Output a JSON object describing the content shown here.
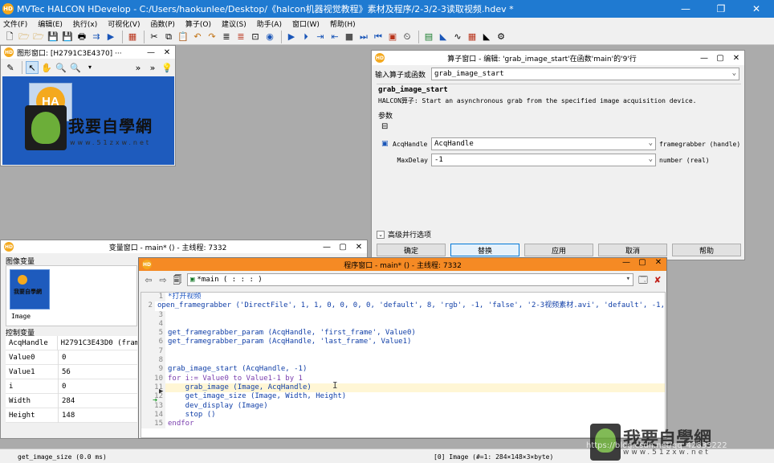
{
  "app": {
    "title": "MVTec HALCON HDevelop - C:/Users/haokunlee/Desktop/《halcon机器视觉教程》素材及程序/2-3/2-3读取视频.hdev *",
    "minimize": "—",
    "maximize": "❐",
    "close": "✕"
  },
  "menu": [
    "文件(F)",
    "编辑(E)",
    "执行(x)",
    "可视化(V)",
    "函数(P)",
    "算子(O)",
    "建议(S)",
    "助手(A)",
    "窗口(W)",
    "帮助(H)"
  ],
  "graphics_window": {
    "title": "图形窗口: [H2791C3E4370] ···",
    "overlay_text": "我要自學網",
    "overlay_sub": "www.51zxw.net"
  },
  "operator_window": {
    "title": "算子窗口 - 编辑: 'grab_image_start'在函数'main'的'9'行",
    "input_label": "输入算子或函数",
    "input_value": "grab_image_start",
    "op_name": "grab_image_start",
    "op_desc": "HALCON算子:  Start an asynchronous grab from the specified image acquisition device.",
    "params_label": "参数",
    "params": [
      {
        "name": "AcqHandle",
        "value": "AcqHandle",
        "type": "framegrabber (handle)"
      },
      {
        "name": "MaxDelay",
        "value": "-1",
        "type": "number (real)"
      }
    ],
    "advanced_label": "高级并行选项",
    "buttons": [
      "确定",
      "替换",
      "应用",
      "取消",
      "帮助"
    ]
  },
  "variable_window": {
    "title": "变量窗口 - main* () - 主线程: 7332",
    "image_section": "图像变量",
    "image_var_name": "Image",
    "control_section": "控制变量",
    "variables": [
      {
        "name": "AcqHandle",
        "value": "H2791C3E43D0 (fram"
      },
      {
        "name": "Value0",
        "value": "0"
      },
      {
        "name": "Value1",
        "value": "56"
      },
      {
        "name": "i",
        "value": "0"
      },
      {
        "name": "Width",
        "value": "284"
      },
      {
        "name": "Height",
        "value": "148"
      }
    ]
  },
  "program_window": {
    "title": "程序窗口 - main* () - 主线程: 7332",
    "procedure": "*main ( : : : )",
    "lines": [
      {
        "n": "1",
        "text": "*打开视频"
      },
      {
        "n": "2",
        "text": "open_framegrabber ('DirectFile', 1, 1, 0, 0, 0, 0, 'default', 8, 'rgb', -1, 'false', '2-3视频素材.avi', 'default', -1,"
      },
      {
        "n": "3",
        "text": ""
      },
      {
        "n": "4",
        "text": ""
      },
      {
        "n": "5",
        "text": "get_framegrabber_param (AcqHandle, 'first_frame', Value0)"
      },
      {
        "n": "6",
        "text": "get_framegrabber_param (AcqHandle, 'last_frame', Value1)"
      },
      {
        "n": "7",
        "text": ""
      },
      {
        "n": "8",
        "text": ""
      },
      {
        "n": "9",
        "text": "grab_image_start (AcqHandle, -1)"
      },
      {
        "n": "10",
        "text": "for i:= Value0 to Value1-1 by 1"
      },
      {
        "n": "11",
        "text": "    grab_image (Image, AcqHandle)"
      },
      {
        "n": "12",
        "text": "    get_image_size (Image, Width, Height)"
      },
      {
        "n": "13",
        "text": "    dev_display (Image)"
      },
      {
        "n": "14",
        "text": "    stop ()"
      },
      {
        "n": "15",
        "text": "endfor"
      }
    ]
  },
  "status": {
    "left": "get_image_size (0.0 ms)",
    "right": "[0] Image (#=1: 284×148×3×byte)",
    "watermark": "https://blog.csdn.net/qq_42833222"
  },
  "colors": {
    "title_blue": "#1f7ad1",
    "program_title_orange": "#f58a24",
    "graphics_bg": "#1e5bbd",
    "halcon_orange": "#f4a91e"
  }
}
